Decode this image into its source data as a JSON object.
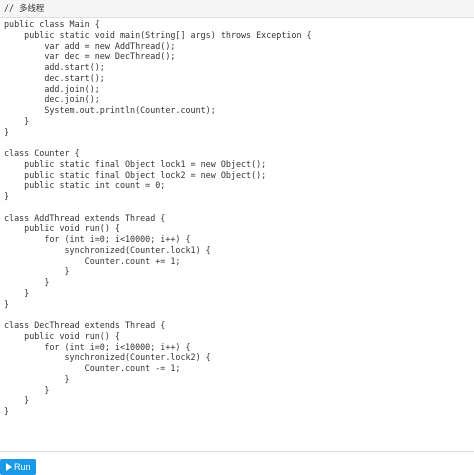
{
  "editor": {
    "comment": "// 多线程",
    "lines": [
      "public class Main {",
      "    public static void main(String[] args) throws Exception {",
      "        var add = new AddThread();",
      "        var dec = new DecThread();",
      "        add.start();",
      "        dec.start();",
      "        add.join();",
      "        dec.join();",
      "        System.out.println(Counter.count);",
      "    }",
      "}",
      "",
      "class Counter {",
      "    public static final Object lock1 = new Object();",
      "    public static final Object lock2 = new Object();",
      "    public static int count = 0;",
      "}",
      "",
      "class AddThread extends Thread {",
      "    public void run() {",
      "        for (int i=0; i<10000; i++) {",
      "            synchronized(Counter.lock1) {",
      "                Counter.count += 1;",
      "            }",
      "        }",
      "    }",
      "}",
      "",
      "class DecThread extends Thread {",
      "    public void run() {",
      "        for (int i=0; i<10000; i++) {",
      "            synchronized(Counter.lock2) {",
      "                Counter.count -= 1;",
      "            }",
      "        }",
      "    }",
      "}"
    ]
  },
  "run_button": {
    "label": "Run",
    "icon": "play-icon",
    "color": "#1a9ae6"
  }
}
